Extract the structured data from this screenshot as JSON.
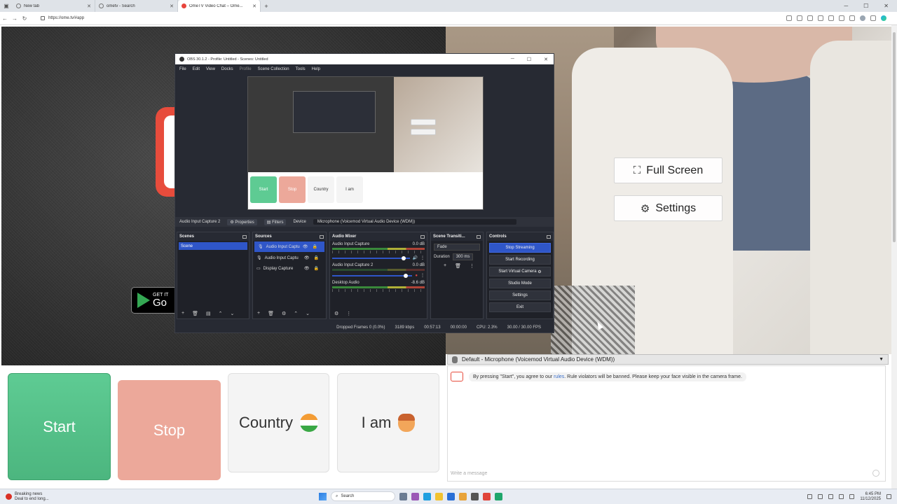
{
  "browser": {
    "tabs": [
      {
        "title": "New tab",
        "active": false
      },
      {
        "title": "ometv - Search",
        "active": false
      },
      {
        "title": "OmeTV Video Chat – Ome...",
        "active": true
      }
    ],
    "url": "https://ome.tv/#app"
  },
  "page": {
    "overlay": {
      "fullscreen_label": "Full Screen",
      "settings_label": "Settings"
    },
    "mic_device": "Default - Microphone (Voicemod Virtual Audio Device (WDM))",
    "buttons": {
      "start": "Start",
      "stop": "Stop",
      "country": "Country",
      "iam": "I am"
    },
    "badge": {
      "line1": "GET IT",
      "line2": "Go"
    },
    "chat": {
      "message_pre": "By pressing \"Start\", you agree to our",
      "message_link": "rules",
      "message_post": ". Rule violators will be banned. Please keep your face visible in the camera frame.",
      "placeholder": "Write a message"
    },
    "colors": {
      "start": "#4cb67f",
      "stop": "#eca89a",
      "accent": "#2f56c8"
    }
  },
  "obs": {
    "title": "OBS 30.1.2 - Profile: Untitled - Scenes: Untitled",
    "menu": [
      "File",
      "Edit",
      "View",
      "Docks",
      "Profile",
      "Scene Collection",
      "Tools",
      "Help"
    ],
    "preview_tiles": {
      "start": "Start",
      "stop": "Stop",
      "country": "Country",
      "iam": "I am"
    },
    "preview_menu": [
      "Full Screen",
      "Settings"
    ],
    "source_bar": {
      "source": "Audio Input Capture 2",
      "properties": "Properties",
      "filters": "Filters",
      "device_label": "Device",
      "device_value": "Microphone (Voicemod Virtual Audio Device (WDM))"
    },
    "docks": {
      "scenes": "Scenes",
      "sources": "Sources",
      "mixer": "Audio Mixer",
      "transitions": "Scene Transiti...",
      "controls": "Controls"
    },
    "scenes": [
      "Scene"
    ],
    "sources": [
      "Audio Input Captu",
      "Audio Input Captu",
      "Display Capture"
    ],
    "mixer": [
      {
        "name": "Audio Input Capture",
        "db": "0.0 dB"
      },
      {
        "name": "Audio Input Capture 2",
        "db": "0.0 dB"
      },
      {
        "name": "Desktop Audio",
        "db": "-8.6 dB"
      }
    ],
    "transition": {
      "type": "Fade",
      "duration_label": "Duration",
      "duration": "300 ms"
    },
    "controls": [
      "Stop Streaming",
      "Start Recording",
      "Start Virtual Camera",
      "Studio Mode",
      "Settings",
      "Exit"
    ],
    "status": {
      "dropped": "Dropped Frames 0 (0.0%)",
      "bitrate": "3189 kbps",
      "stream_time": "00:57:13",
      "rec_time": "00:00:00",
      "cpu": "CPU: 2.3%",
      "fps": "30.00 / 30.00 FPS"
    }
  },
  "taskbar": {
    "news_title": "Breaking news",
    "news_sub": "Deal to end long...",
    "search": "Search",
    "time": "6:45 PM",
    "date": "11/12/2025"
  }
}
